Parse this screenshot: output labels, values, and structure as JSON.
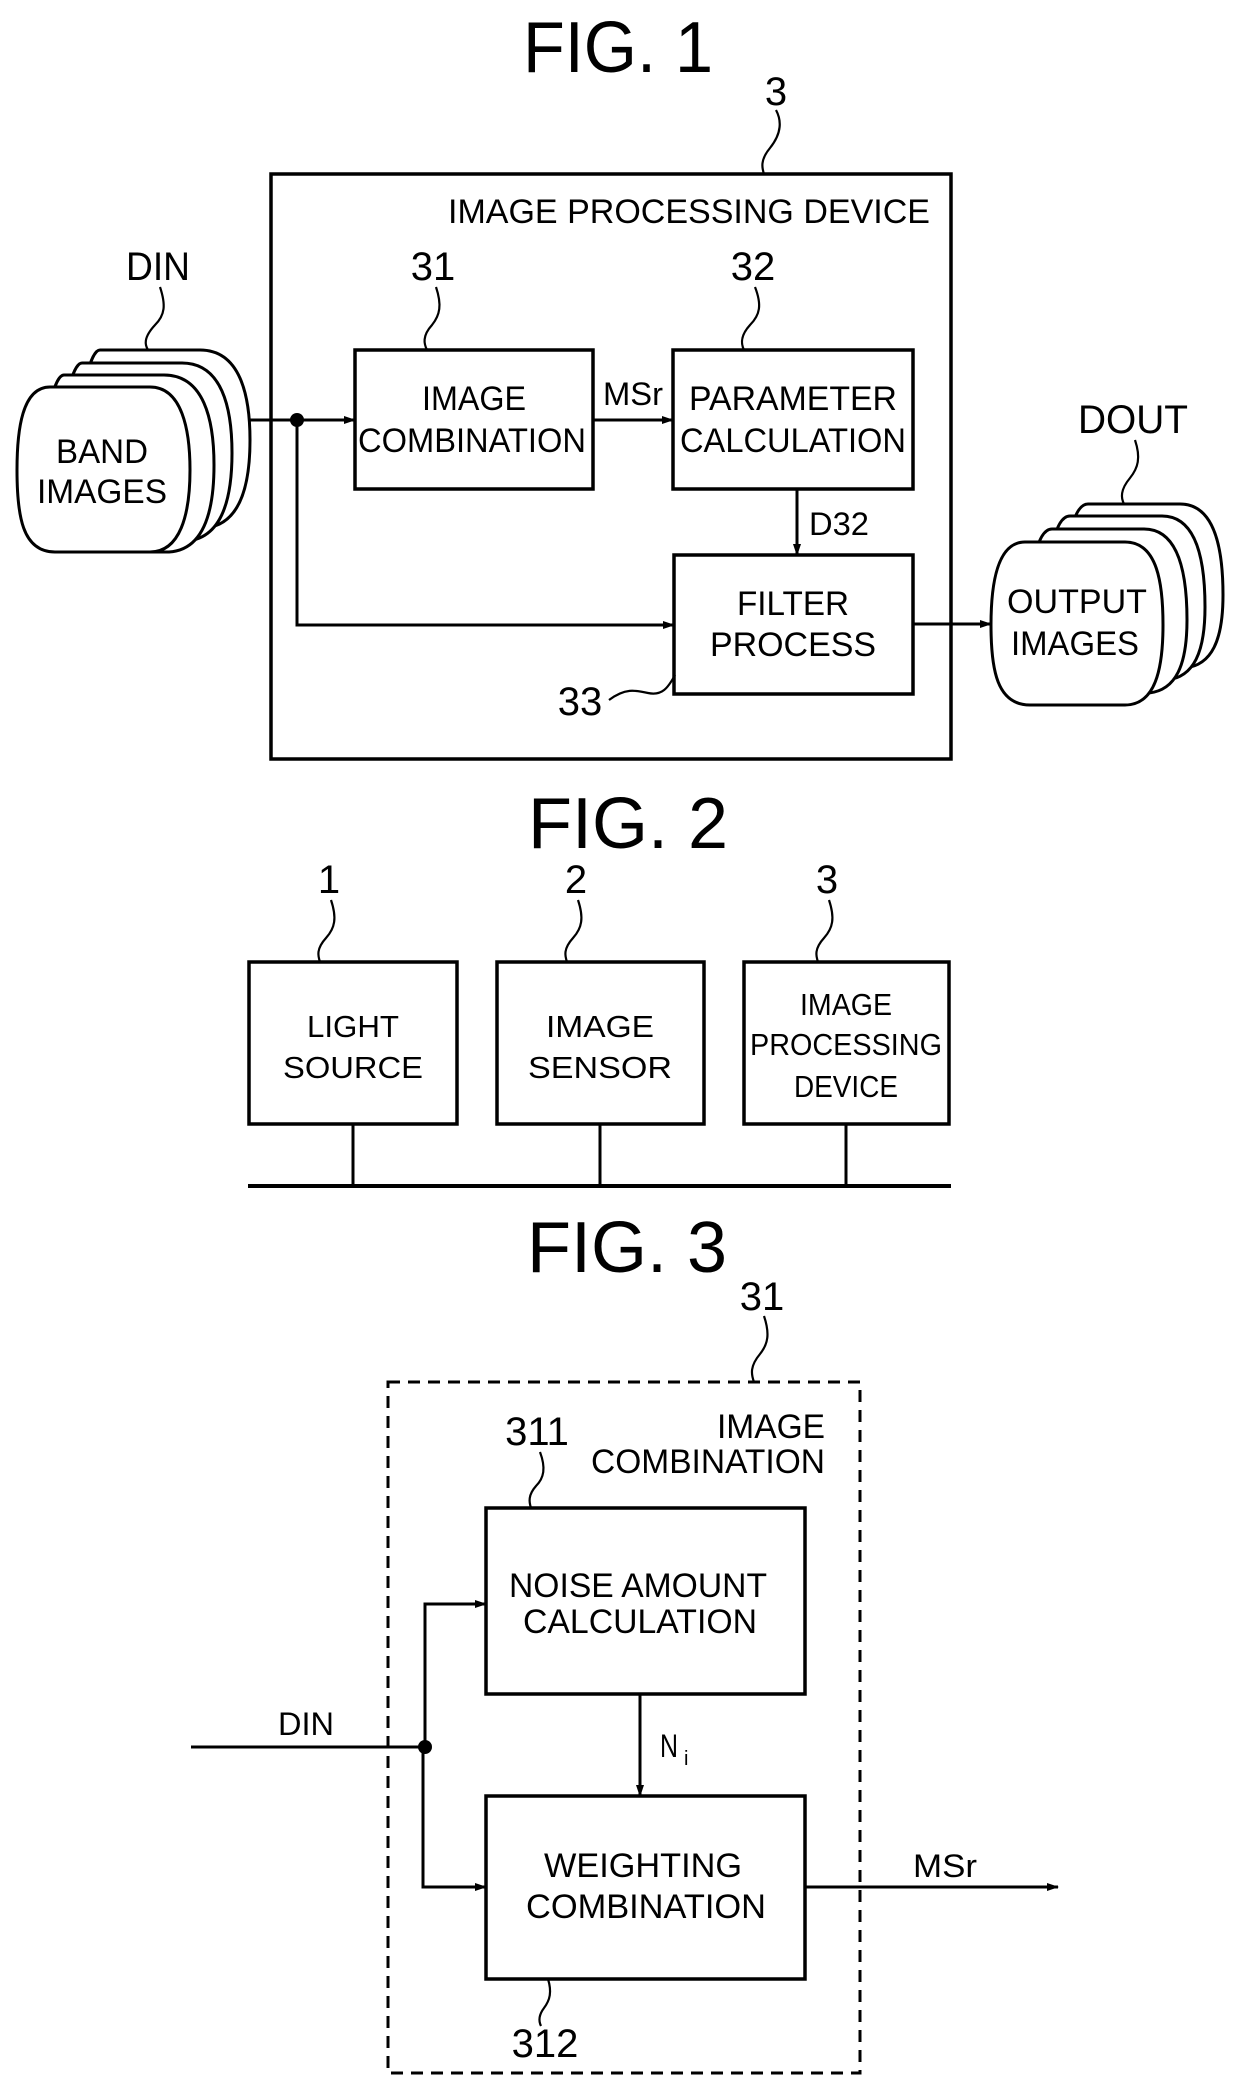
{
  "fig1": {
    "title": "FIG. 1",
    "device_ref": "3",
    "device_label": "IMAGE PROCESSING DEVICE",
    "input": {
      "ref": "DIN",
      "line1": "BAND",
      "line2": "IMAGES"
    },
    "output": {
      "ref": "DOUT",
      "line1": "OUTPUT",
      "line2": "IMAGES"
    },
    "blocks": [
      {
        "ref": "31",
        "line1": "IMAGE",
        "line2": "COMBINATION"
      },
      {
        "ref": "32",
        "line1": "PARAMETER",
        "line2": "CALCULATION"
      },
      {
        "ref": "33",
        "line1": "FILTER",
        "line2": "PROCESS"
      }
    ],
    "signals": {
      "msr": "MSr",
      "d32": "D32"
    }
  },
  "fig2": {
    "title": "FIG. 2",
    "blocks": [
      {
        "ref": "1",
        "lines": [
          "LIGHT",
          "SOURCE"
        ]
      },
      {
        "ref": "2",
        "lines": [
          "IMAGE",
          "SENSOR"
        ]
      },
      {
        "ref": "3",
        "lines": [
          "IMAGE",
          "PROCESSING",
          "DEVICE"
        ]
      }
    ]
  },
  "fig3": {
    "title": "FIG. 3",
    "group_ref": "31",
    "group_label_line1": "IMAGE",
    "group_label_line2": "COMBINATION",
    "input_label": "DIN",
    "output_label": "MSr",
    "noise_signal": "N",
    "noise_signal_sub": "i",
    "blocks": [
      {
        "ref": "311",
        "line1": "NOISE AMOUNT",
        "line2": "CALCULATION"
      },
      {
        "ref": "312",
        "line1": "WEIGHTING",
        "line2": "COMBINATION"
      }
    ]
  }
}
